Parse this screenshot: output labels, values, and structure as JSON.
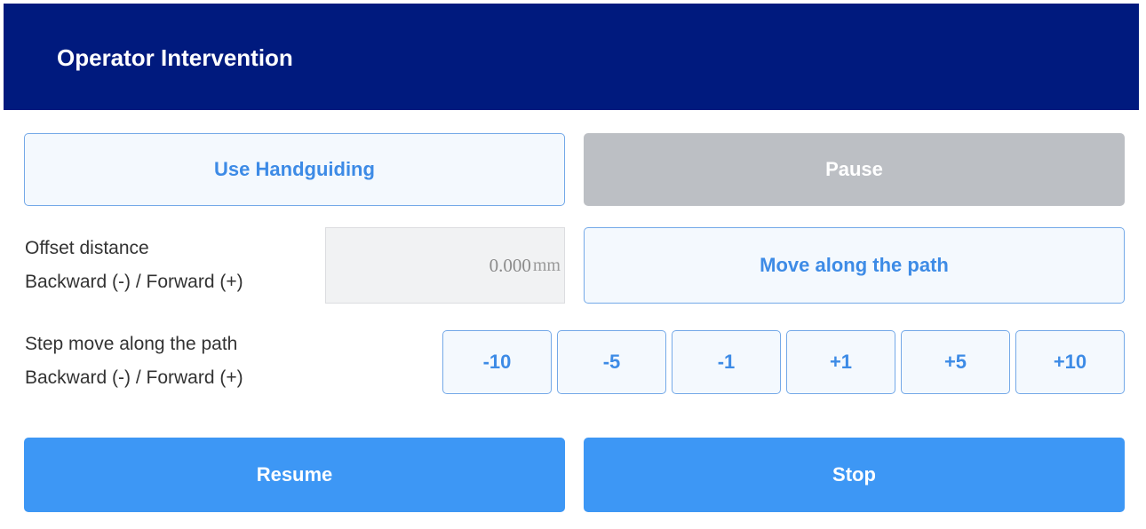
{
  "header": {
    "title": "Operator Intervention"
  },
  "buttons": {
    "handguiding": "Use Handguiding",
    "pause": "Pause",
    "move_along_path": "Move along the path",
    "resume": "Resume",
    "stop": "Stop"
  },
  "offset": {
    "label_line1": "Offset distance",
    "label_line2": "Backward (-) / Forward (+)",
    "value": "0.000",
    "unit": "mm"
  },
  "step": {
    "label_line1": "Step move along the path",
    "label_line2": "Backward (-) / Forward (+)",
    "buttons": [
      "-10",
      "-5",
      "-1",
      "+1",
      "+5",
      "+10"
    ]
  },
  "colors": {
    "header_bg": "#001a7e",
    "primary": "#3d97f5",
    "outline_text": "#3d8be6",
    "disabled": "#bcbfc4"
  }
}
